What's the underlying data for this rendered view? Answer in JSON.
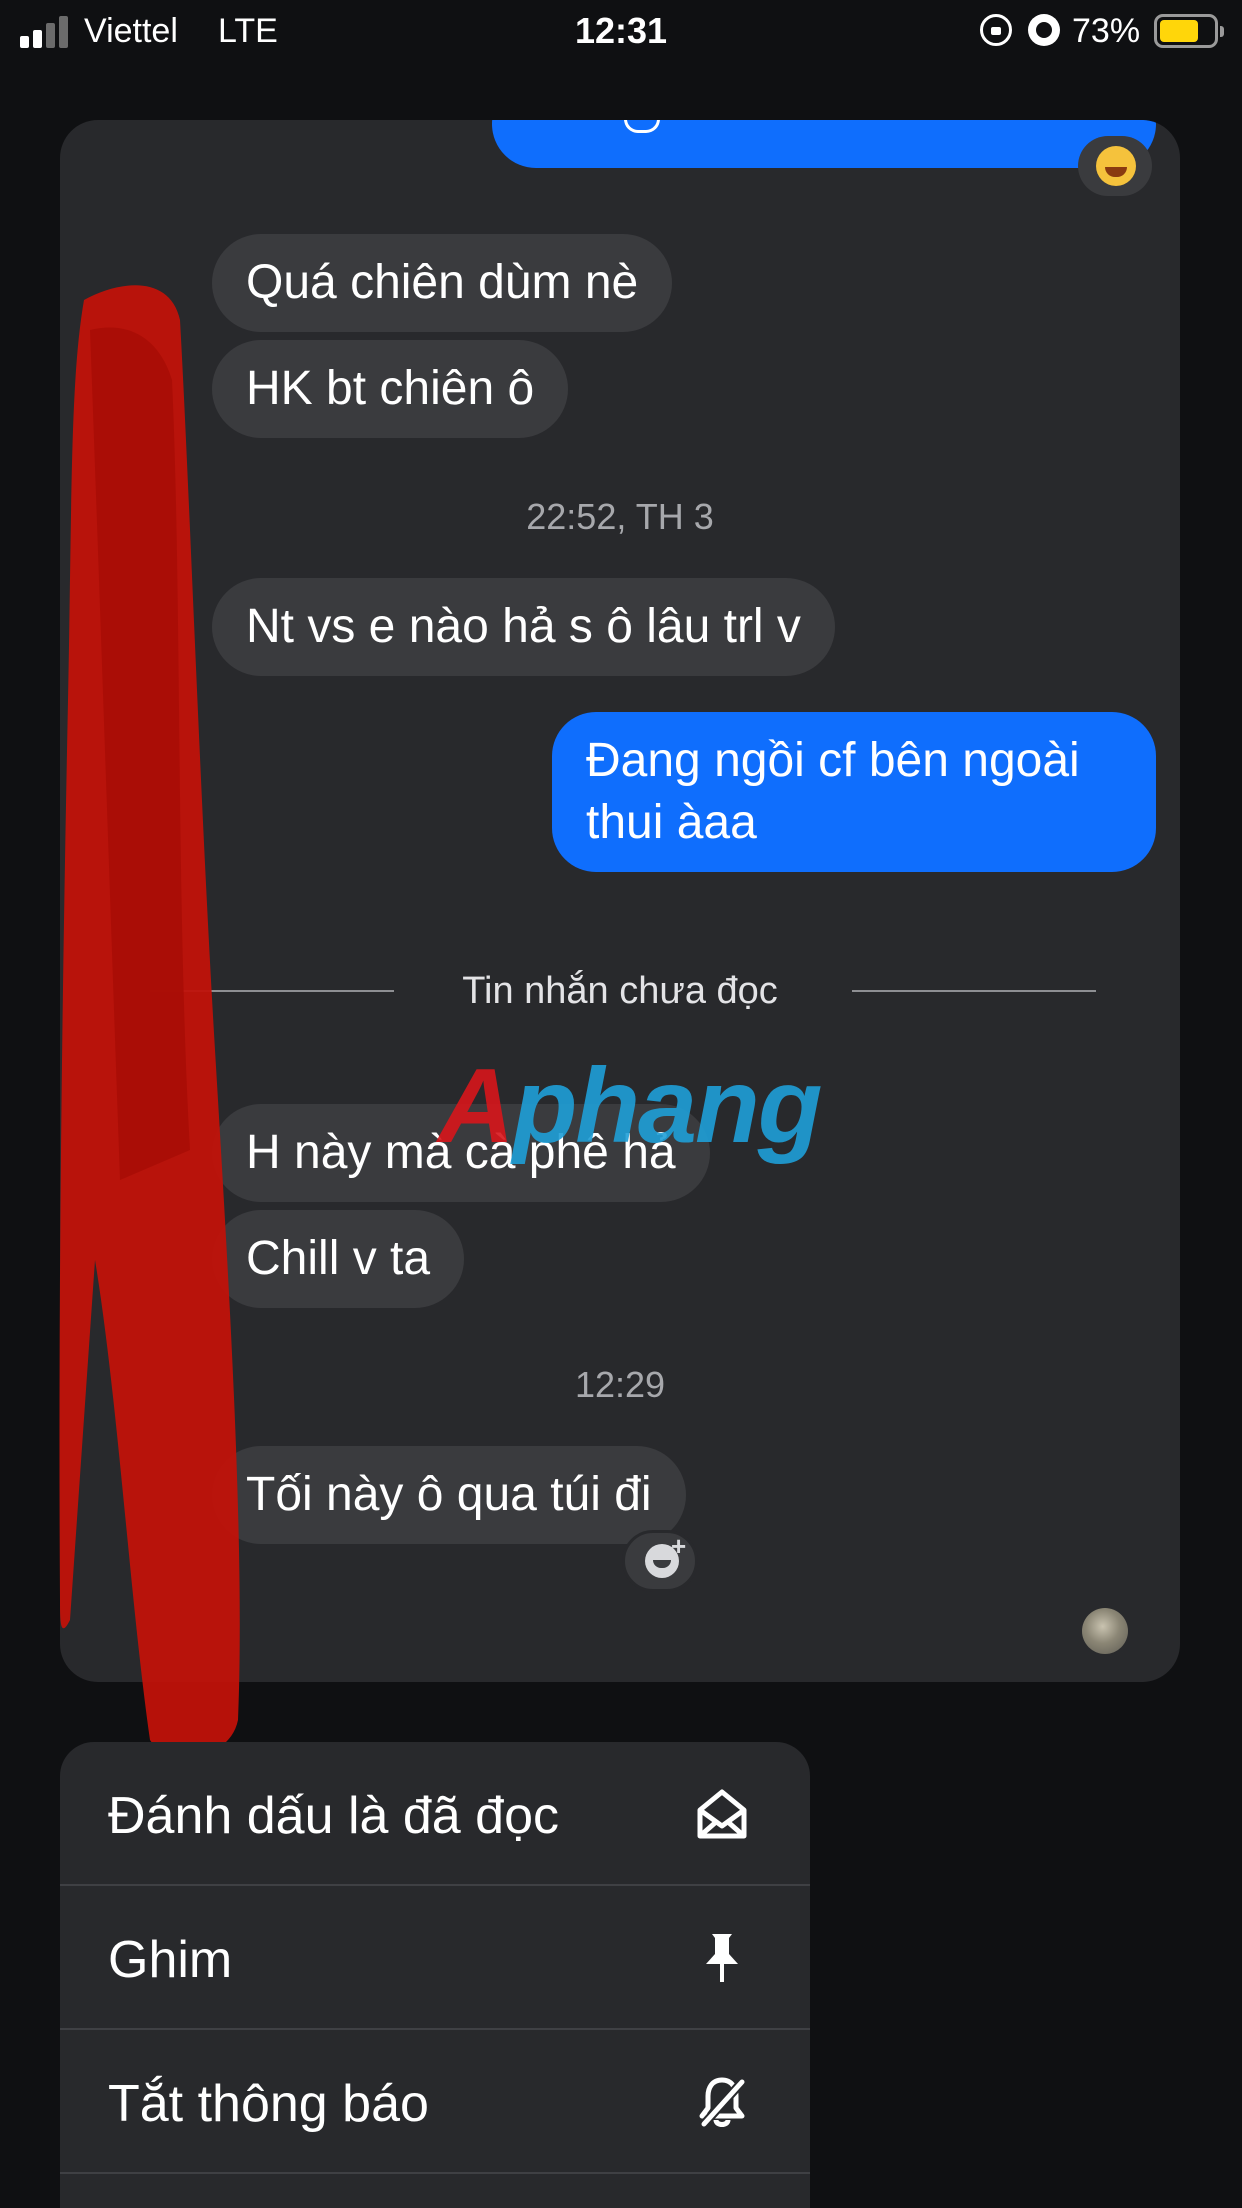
{
  "status_bar": {
    "carrier": "Viettel",
    "network": "LTE",
    "time": "12:31",
    "battery_percent": "73%",
    "battery_level": 0.73,
    "icons": [
      "signal-icon",
      "rotation-lock-icon",
      "alarm-icon",
      "battery-icon"
    ]
  },
  "conversation": {
    "top_reaction": "laughing-face-emoji",
    "messages_group_1": [
      {
        "text": "Quá chiên dùm nè",
        "direction": "incoming"
      },
      {
        "text": "HK bt chiên ô",
        "direction": "incoming"
      }
    ],
    "timestamp_1": "22:52, TH 3",
    "message_3": {
      "text": "Nt vs e nào hả s ô lâu trl v",
      "direction": "incoming"
    },
    "message_4": {
      "text": "Đang ngồi cf bên ngoài thui àaa",
      "direction": "outgoing"
    },
    "unread_divider": "Tin nhắn chưa đọc",
    "messages_group_2": [
      {
        "text": "H này mà cà phê hả",
        "direction": "incoming"
      },
      {
        "text": "Chill v ta",
        "direction": "incoming"
      }
    ],
    "timestamp_2": "12:29",
    "message_7": {
      "text": "Tối này ô qua túi đi",
      "direction": "incoming"
    },
    "watermark": "Aphang"
  },
  "context_menu": {
    "items": [
      {
        "label": "Đánh dấu là đã đọc",
        "icon": "mark-as-read-envelope-icon"
      },
      {
        "label": "Ghim",
        "icon": "pin-icon"
      },
      {
        "label": "Tắt thông báo",
        "icon": "bell-slash-icon"
      }
    ]
  },
  "colors": {
    "background": "#0f1012",
    "card": "#28292c",
    "incoming_bubble": "#3a3b3e",
    "outgoing_bubble": "#0f6efd",
    "battery": "#ffd60a"
  }
}
